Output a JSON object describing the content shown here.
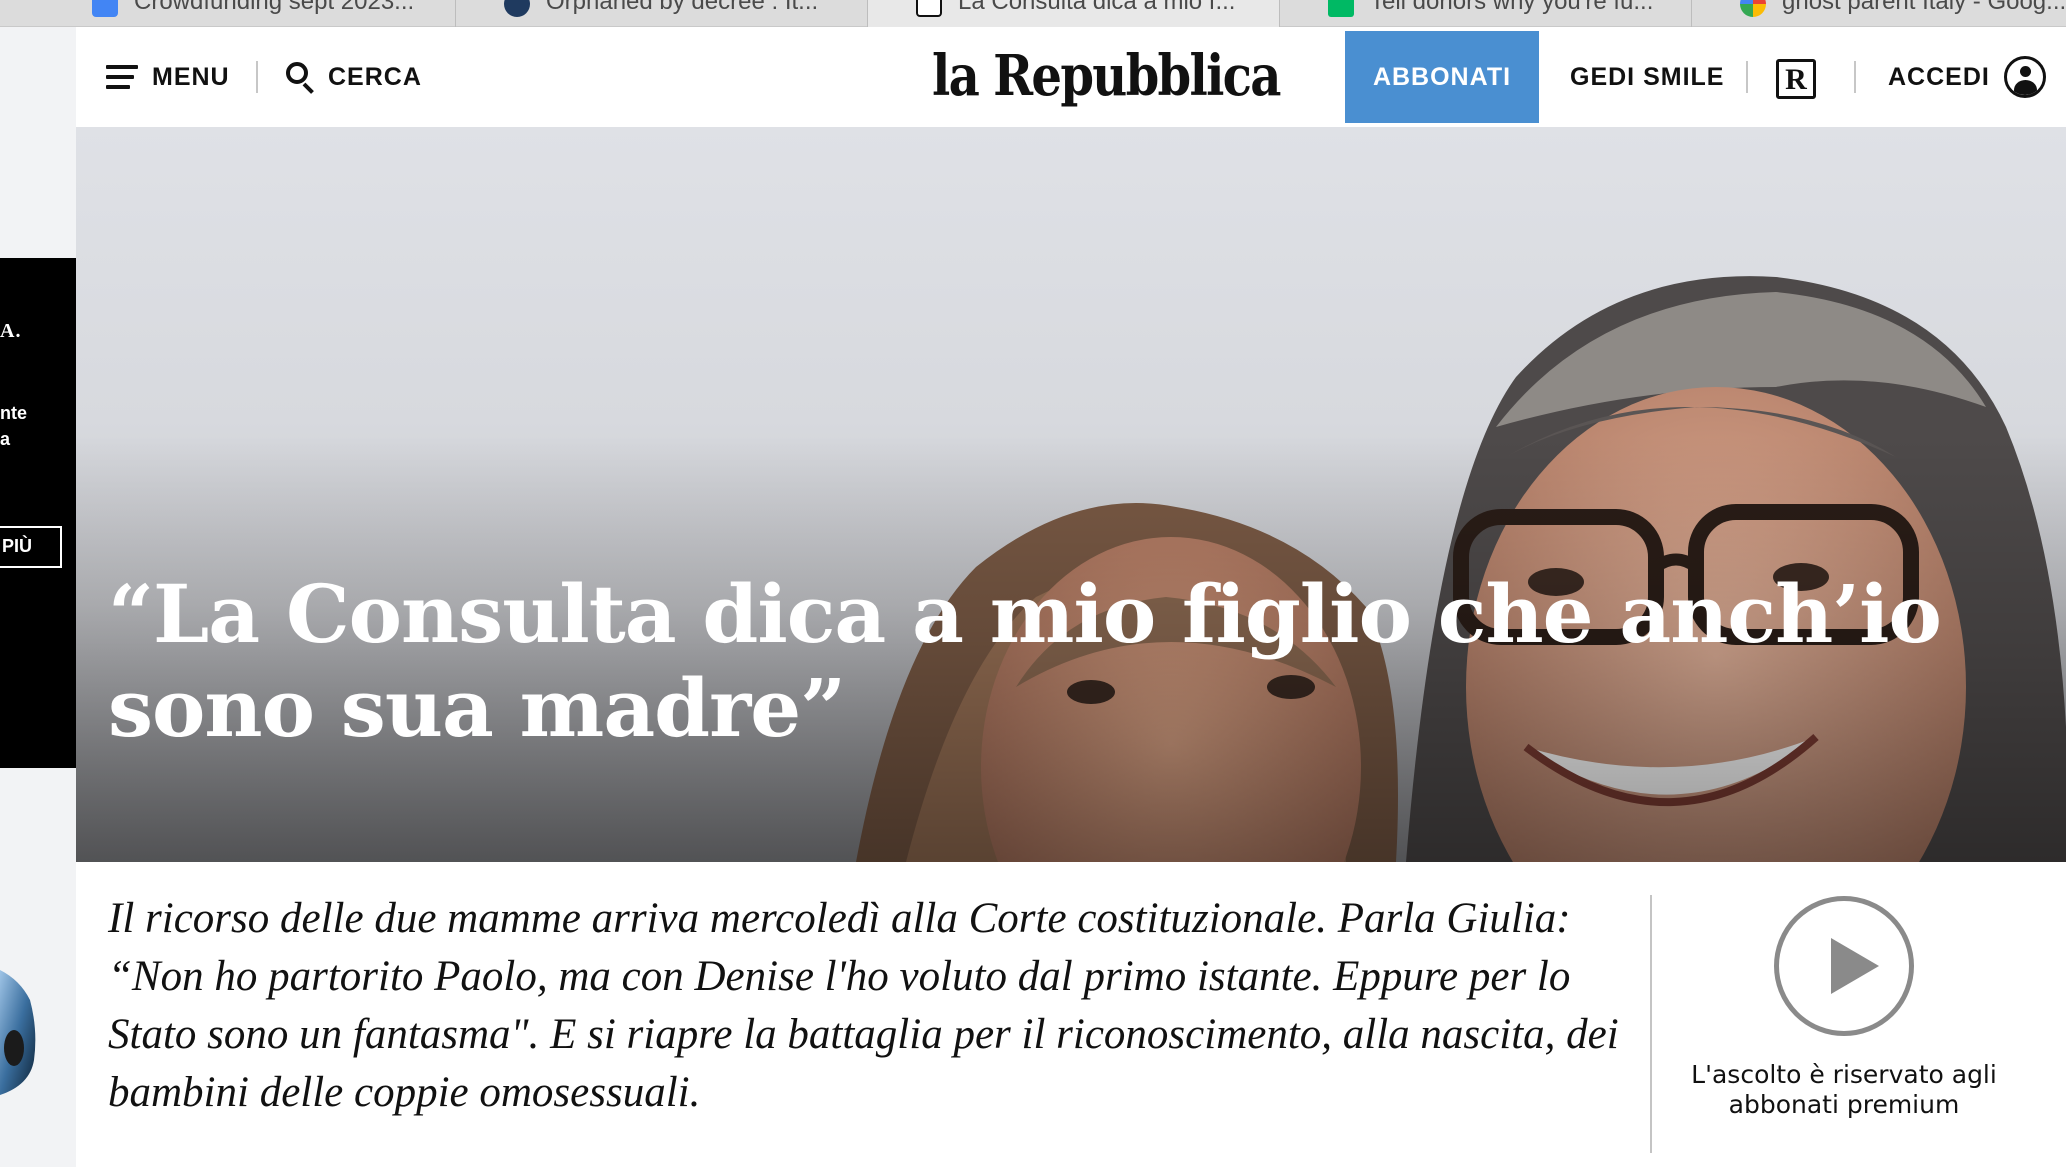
{
  "browser": {
    "tabs": [
      {
        "title": "Crowdfunding sept 2023...",
        "favicon": "docs-icon"
      },
      {
        "title": "Orphaned by decree : It...",
        "favicon": "globe-icon"
      },
      {
        "title": "La Consulta dica a mio f...",
        "favicon": "repubblica-r-icon"
      },
      {
        "title": "Tell donors why you're fu...",
        "favicon": "gofundme-icon"
      },
      {
        "title": "ghost parent Italy - Goog...",
        "favicon": "google-icon"
      }
    ]
  },
  "ad": {
    "brand": "A.",
    "text": "nte\na",
    "cta": "PIÙ"
  },
  "header": {
    "menu_label": "MENU",
    "search_label": "CERCA",
    "logo": "la Repubblica",
    "subscribe_label": "ABBONATI",
    "gedi_label": "GEDI SMILE",
    "r_label": "R",
    "login_label": "ACCEDI"
  },
  "article": {
    "headline": "“La Consulta dica a mio figlio che anch’io sono sua madre”",
    "summary": "Il ricorso delle due mamme arriva mercoledì alla Corte costituzionale. Parla Giulia: “Non ho partorito Paolo, ma con Denise l'ho voluto dal primo istante. Eppure per lo Stato sono un fantasma\".  E si riapre la battaglia per il riconoscimento, alla nascita, dei bambini delle coppie omosessuali."
  },
  "audio": {
    "note": "L'ascolto è riservato agli abbonati premium"
  },
  "colors": {
    "accent": "#4a8fd1",
    "text": "#111111",
    "hero_text": "#ffffff"
  }
}
